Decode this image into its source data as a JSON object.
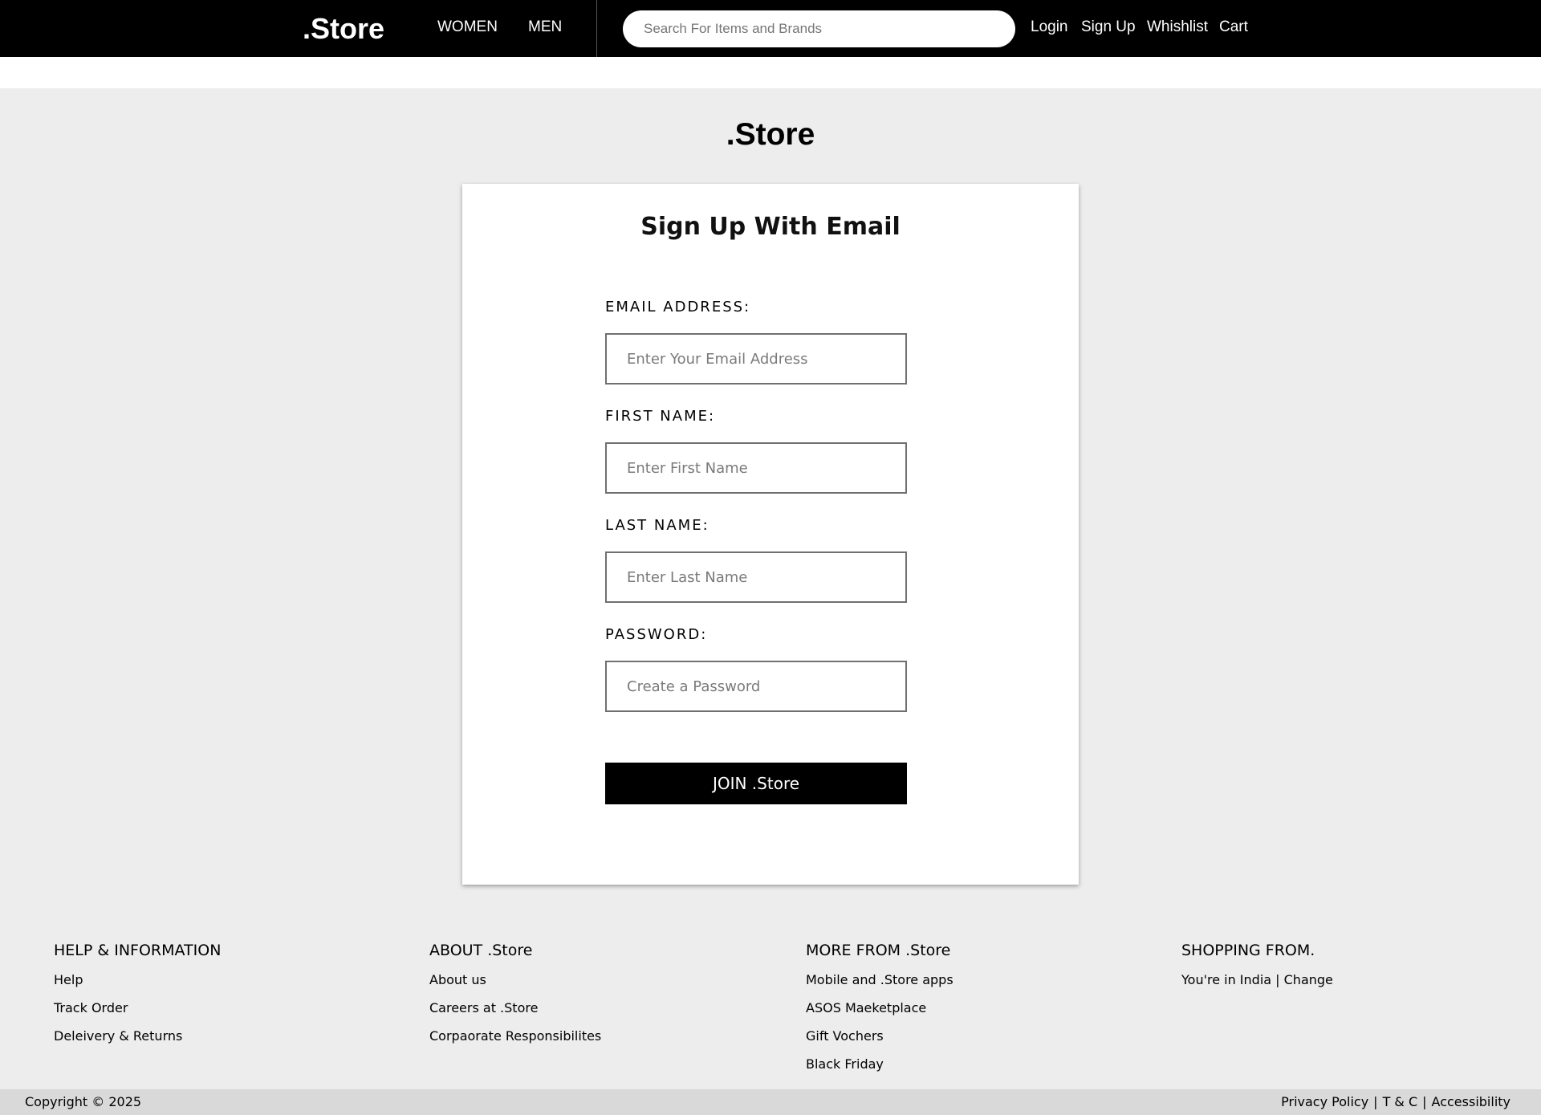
{
  "header": {
    "logo": ".Store",
    "nav": [
      "WOMEN",
      "MEN"
    ],
    "search_placeholder": "Search For Items and Brands",
    "links": [
      "Login",
      "Sign Up",
      "Whishlist",
      "Cart"
    ]
  },
  "brand_heading": ".Store",
  "form": {
    "title": "Sign Up With Email",
    "fields": [
      {
        "label": "EMAIL ADDRESS:",
        "placeholder": "Enter Your Email Address"
      },
      {
        "label": "FIRST NAME:",
        "placeholder": "Enter First Name"
      },
      {
        "label": "LAST NAME:",
        "placeholder": "Enter Last Name"
      },
      {
        "label": "PASSWORD:",
        "placeholder": "Create a Password"
      }
    ],
    "submit_label": "JOIN .Store"
  },
  "footer": {
    "columns": [
      {
        "heading": "HELP & INFORMATION",
        "links": [
          "Help",
          "Track Order",
          "Deleivery & Returns"
        ]
      },
      {
        "heading": "ABOUT .Store",
        "links": [
          "About us",
          "Careers at .Store",
          "Corpaorate Responsibilites"
        ]
      },
      {
        "heading": "MORE FROM .Store",
        "links": [
          "Mobile and .Store apps",
          "ASOS Maeketplace",
          "Gift Vochers",
          "Black Friday"
        ]
      },
      {
        "heading": "SHOPPING FROM.",
        "links": [
          "You're in India | Change"
        ]
      }
    ],
    "copyright": "Copyright © 2025",
    "legal": [
      "Privacy Policy",
      "T & C",
      "Accessibility"
    ],
    "legal_separator": "|"
  }
}
